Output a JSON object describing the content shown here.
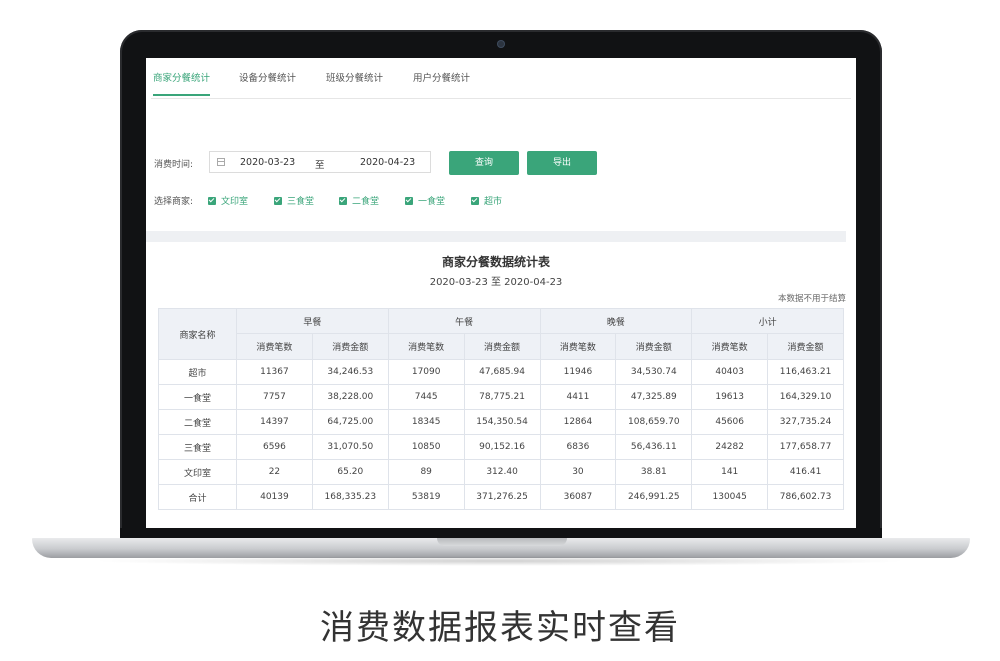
{
  "tabs": [
    {
      "label": "商家分餐统计",
      "active": true
    },
    {
      "label": "设备分餐统计",
      "active": false
    },
    {
      "label": "班级分餐统计",
      "active": false
    },
    {
      "label": "用户分餐统计",
      "active": false
    }
  ],
  "filters": {
    "time_label": "消费时间:",
    "start_date": "2020-03-23",
    "range_sep": "至",
    "end_date": "2020-04-23",
    "query_label": "查询",
    "export_label": "导出",
    "merchant_label": "选择商家:",
    "merchants": [
      {
        "label": "文印室",
        "checked": true
      },
      {
        "label": "三食堂",
        "checked": true
      },
      {
        "label": "二食堂",
        "checked": true
      },
      {
        "label": "一食堂",
        "checked": true
      },
      {
        "label": "超市",
        "checked": true
      }
    ]
  },
  "report": {
    "title": "商家分餐数据统计表",
    "range": "2020-03-23 至 2020-04-23",
    "note": "本数据不用于结算",
    "header_name": "商家名称",
    "groups": [
      "早餐",
      "午餐",
      "晚餐",
      "小计"
    ],
    "sub_count": "消费笔数",
    "sub_amount": "消费金额",
    "rows": [
      [
        "超市",
        "11367",
        "34,246.53",
        "17090",
        "47,685.94",
        "11946",
        "34,530.74",
        "40403",
        "116,463.21"
      ],
      [
        "一食堂",
        "7757",
        "38,228.00",
        "7445",
        "78,775.21",
        "4411",
        "47,325.89",
        "19613",
        "164,329.10"
      ],
      [
        "二食堂",
        "14397",
        "64,725.00",
        "18345",
        "154,350.54",
        "12864",
        "108,659.70",
        "45606",
        "327,735.24"
      ],
      [
        "三食堂",
        "6596",
        "31,070.50",
        "10850",
        "90,152.16",
        "6836",
        "56,436.11",
        "24282",
        "177,658.77"
      ],
      [
        "文印室",
        "22",
        "65.20",
        "89",
        "312.40",
        "30",
        "38.81",
        "141",
        "416.41"
      ],
      [
        "合计",
        "40139",
        "168,335.23",
        "53819",
        "371,276.25",
        "36087",
        "246,991.25",
        "130045",
        "786,602.73"
      ]
    ]
  },
  "caption": "消费数据报表实时查看",
  "colors": {
    "accent": "#3aa57a",
    "header_bg": "#eef1f6"
  }
}
